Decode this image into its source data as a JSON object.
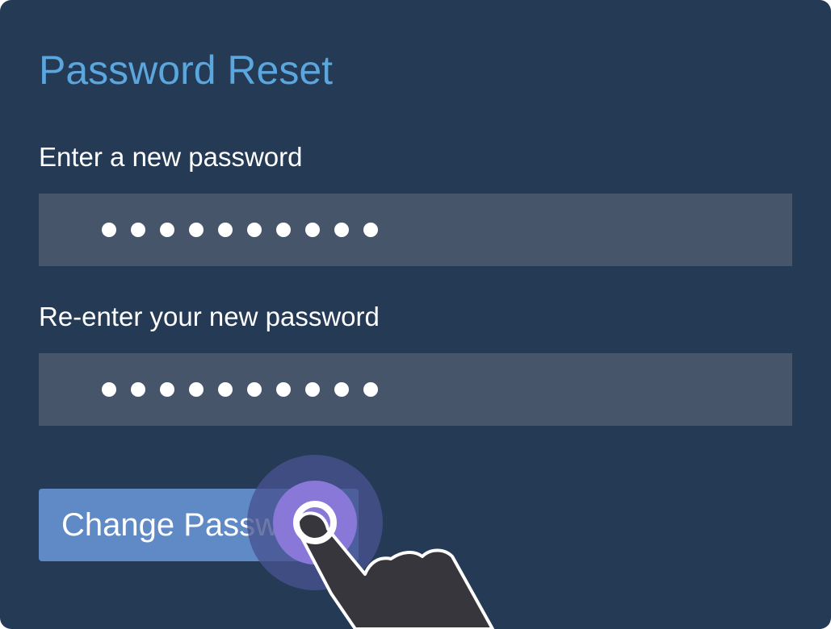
{
  "form": {
    "title": "Password Reset",
    "new_password_label": "Enter a new password",
    "confirm_password_label": "Re-enter your new password",
    "new_password_mask_count": 10,
    "confirm_password_mask_count": 10,
    "submit_label": "Change Password"
  },
  "colors": {
    "panel_background": "#243a55",
    "title": "#5aa6dd",
    "field_background": "#465569",
    "button_background": "#5f8ac6",
    "tap_highlight": "#8a78d8",
    "hand": "#36363c"
  },
  "icons": {
    "pointer": "hand-pointer-icon",
    "tap": "tap-indicator-icon"
  }
}
